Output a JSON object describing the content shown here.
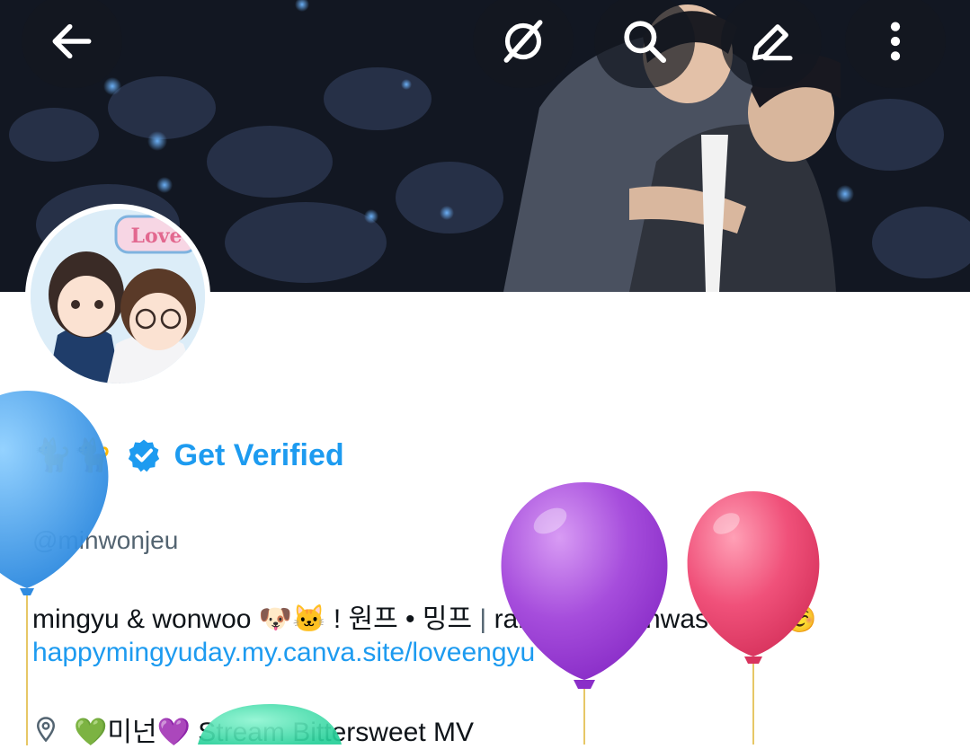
{
  "header": {
    "back_icon": "back-arrow-icon",
    "actions": [
      "grok-icon",
      "search-icon",
      "edit-icon",
      "more-icon"
    ]
  },
  "profile": {
    "name_emoji": "🐈🐈",
    "verified_label": "Get Verified",
    "handle": "@minwonjeu",
    "bio_text": "mingyu & wonwoo 🐶🐱 ! 원프 • 밍프",
    "bio_sep": "|",
    "bio_extra": "random manhwas ☺️☺️☺️",
    "link": "happymingyuday.my.canva.site/loveengyu",
    "location_icon": "location-pin-icon",
    "location": "💚미넌💜 Stream Bittersweet MV"
  },
  "avatar_art_text": "Love",
  "colors": {
    "accent": "#1d9bf0",
    "balloon_blue": "#3b97e3",
    "balloon_purple": "#9b3fd6",
    "balloon_pink": "#ef4a72",
    "balloon_green": "#33d9a4"
  }
}
